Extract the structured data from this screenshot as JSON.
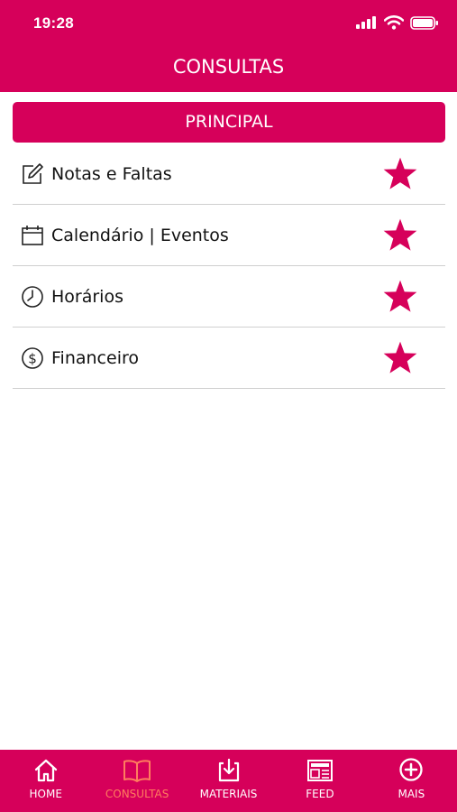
{
  "status_bar": {
    "time": "19:28"
  },
  "header": {
    "title": "CONSULTAS"
  },
  "section": {
    "title": "PRINCIPAL"
  },
  "menu": [
    {
      "label": "Notas e Faltas",
      "icon": "edit-icon",
      "starred": true
    },
    {
      "label": "Calendário | Eventos",
      "icon": "calendar-icon",
      "starred": true
    },
    {
      "label": "Horários",
      "icon": "clock-icon",
      "starred": true
    },
    {
      "label": "Financeiro",
      "icon": "dollar-icon",
      "starred": true
    }
  ],
  "tabs": [
    {
      "label": "HOME",
      "icon": "home-icon",
      "active": false
    },
    {
      "label": "CONSULTAS",
      "icon": "book-icon",
      "active": true
    },
    {
      "label": "MATERIAIS",
      "icon": "download-icon",
      "active": false
    },
    {
      "label": "FEED",
      "icon": "newspaper-icon",
      "active": false
    },
    {
      "label": "MAIS",
      "icon": "plus-circle-icon",
      "active": false
    }
  ],
  "colors": {
    "brand": "#d6005a",
    "active_tab": "#ff7d5e",
    "divider": "#cfcfcf"
  }
}
